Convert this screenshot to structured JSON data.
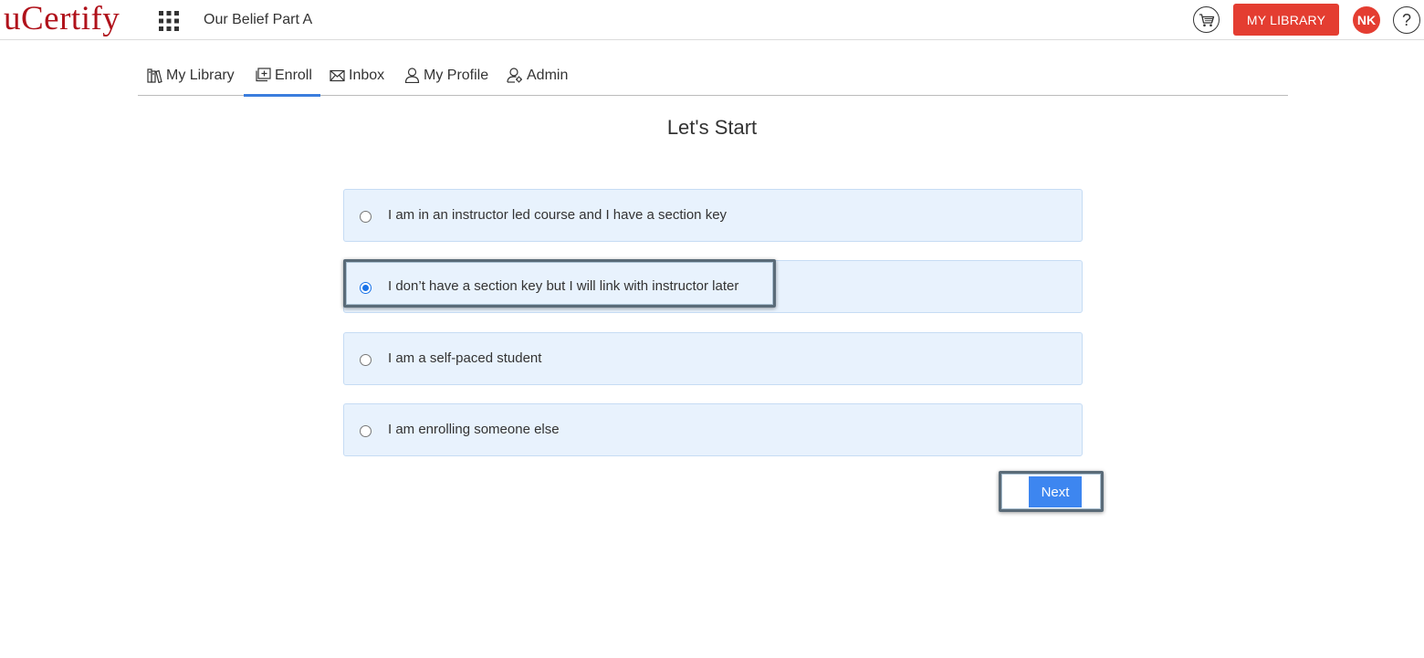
{
  "header": {
    "logo": "uCertify",
    "course_title": "Our Belief Part A",
    "my_library_label": "MY LIBRARY",
    "avatar_initials": "NK",
    "help_label": "?"
  },
  "nav": {
    "items": [
      {
        "label": "My Library",
        "icon": "library-icon"
      },
      {
        "label": "Enroll",
        "icon": "enroll-icon",
        "active": true
      },
      {
        "label": "Inbox",
        "icon": "inbox-icon"
      },
      {
        "label": "My Profile",
        "icon": "profile-icon"
      },
      {
        "label": "Admin",
        "icon": "admin-icon"
      }
    ]
  },
  "main": {
    "heading": "Let's Start",
    "options": [
      {
        "label": "I am in an instructor led course and I have a section key",
        "checked": false
      },
      {
        "label": "I don’t have a section key but I will link with instructor later",
        "checked": true
      },
      {
        "label": "I am a self-paced student",
        "checked": false
      },
      {
        "label": "I am enrolling someone else",
        "checked": false
      }
    ],
    "next_label": "Next"
  },
  "colors": {
    "brand_red": "#b0121b",
    "button_red": "#e43d31",
    "accent_blue": "#3d86f0",
    "option_bg": "#e8f2fd"
  }
}
